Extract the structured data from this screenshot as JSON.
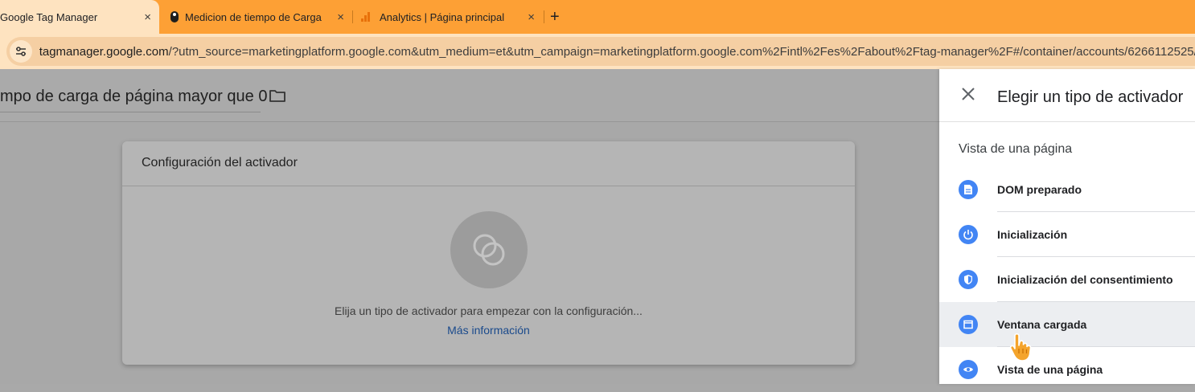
{
  "browser": {
    "tabs": [
      {
        "title": "Google Tag Manager",
        "active": true
      },
      {
        "title": "Medicion de tiempo de Carga",
        "active": false
      },
      {
        "title": "Analytics | Página principal",
        "active": false
      }
    ],
    "new_tab": "+",
    "tab_close": "×",
    "url_host": "tagmanager.google.com",
    "url_rest": "/?utm_source=marketingplatform.google.com&utm_medium=et&utm_campaign=marketingplatform.google.com%2Fintl%2Fes%2Fabout%2Ftag-manager%2F#/container/accounts/6266112525/..."
  },
  "page": {
    "title": "mpo de carga de página mayor que 0",
    "card_title": "Configuración del activador",
    "empty_text": "Elija un tipo de activador para empezar con la configuración...",
    "learn_more": "Más información"
  },
  "panel": {
    "title": "Elegir un tipo de activador",
    "section": "Vista de una página",
    "items": [
      {
        "label": "DOM preparado",
        "icon": "document-icon"
      },
      {
        "label": "Inicialización",
        "icon": "power-icon"
      },
      {
        "label": "Inicialización del consentimiento",
        "icon": "shield-icon"
      },
      {
        "label": "Ventana cargada",
        "icon": "window-icon"
      },
      {
        "label": "Vista de una página",
        "icon": "eye-icon"
      }
    ]
  },
  "colors": {
    "tabstrip": "#fda035",
    "accent_blue": "#4285f4",
    "link": "#1a4a8c"
  }
}
